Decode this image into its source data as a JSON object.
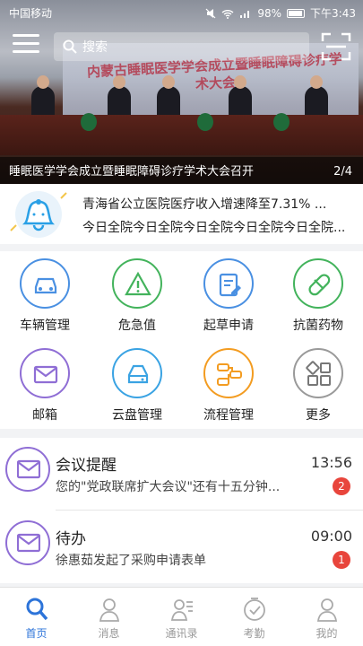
{
  "status_bar": {
    "carrier": "中国移动",
    "battery": "98%",
    "time": "下午3:43"
  },
  "header": {
    "search_placeholder": "搜索"
  },
  "banner": {
    "image_text": "内蒙古睡眠医学学会成立暨睡眠障碍诊疗学术大会",
    "caption": "睡眠医学学会成立暨睡眠障碍诊疗学术大会召开",
    "pager": "2/4"
  },
  "notice": {
    "line1": "青海省公立医院医疗收入增速降至7.31% ...",
    "line2": "今日全院今日全院今日全院今日全院今日全院..."
  },
  "grid": [
    {
      "label": "车辆管理",
      "icon": "car-icon",
      "color": "#4a90e2"
    },
    {
      "label": "危急值",
      "icon": "warning-icon",
      "color": "#43b35c"
    },
    {
      "label": "起草申请",
      "icon": "document-edit-icon",
      "color": "#4a90e2"
    },
    {
      "label": "抗菌药物",
      "icon": "pill-icon",
      "color": "#43b35c"
    },
    {
      "label": "邮箱",
      "icon": "mail-icon",
      "color": "#8f6ed5"
    },
    {
      "label": "云盘管理",
      "icon": "cloud-drive-icon",
      "color": "#3aa3e3"
    },
    {
      "label": "流程管理",
      "icon": "workflow-icon",
      "color": "#f39c21"
    },
    {
      "label": "更多",
      "icon": "more-grid-icon",
      "color": "#9a9a9a"
    }
  ],
  "messages": [
    {
      "title": "会议提醒",
      "time": "13:56",
      "subtitle": "您的\"党政联席扩大会议\"还有十五分钟...",
      "badge": "2"
    },
    {
      "title": "待办",
      "time": "09:00",
      "subtitle": "徐惠茹发起了采购申请表单",
      "badge": "1"
    }
  ],
  "tabs": [
    {
      "label": "首页",
      "icon": "search-home-icon",
      "active": true
    },
    {
      "label": "消息",
      "icon": "message-icon"
    },
    {
      "label": "通讯录",
      "icon": "contacts-icon"
    },
    {
      "label": "考勤",
      "icon": "attendance-clock-icon"
    },
    {
      "label": "我的",
      "icon": "profile-icon"
    }
  ],
  "colors": {
    "accent": "#2d74d9",
    "badge": "#e8453c"
  }
}
